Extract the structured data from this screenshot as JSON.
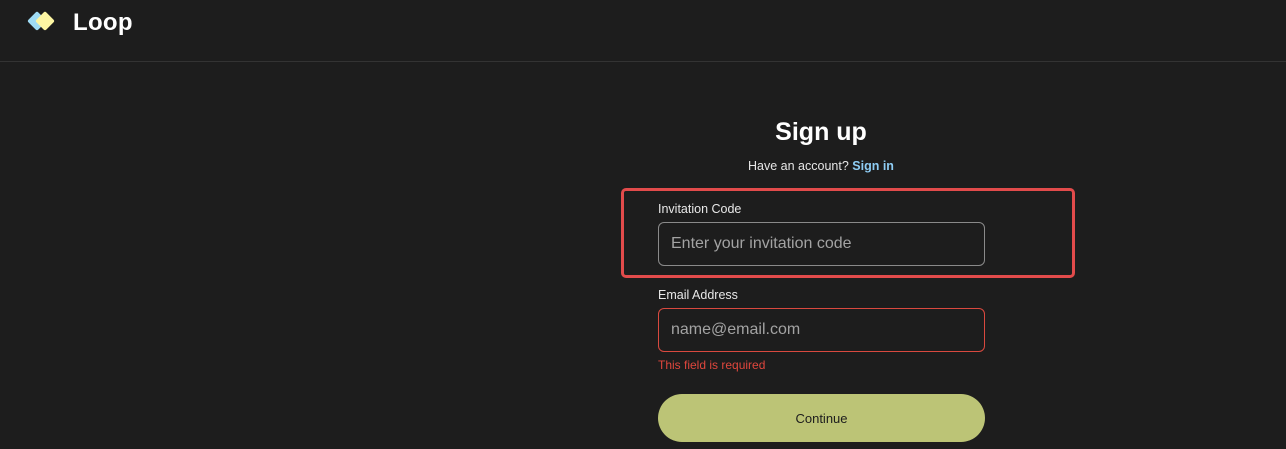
{
  "brand": {
    "name": "Loop",
    "colors": {
      "primary": "#fdf6a3",
      "secondary": "#9fdcf5"
    }
  },
  "signup": {
    "title": "Sign up",
    "have_account_text": "Have an account?",
    "sign_in_link": "Sign in",
    "invitation_code": {
      "label": "Invitation Code",
      "placeholder": "Enter your invitation code",
      "value": ""
    },
    "email": {
      "label": "Email Address",
      "placeholder": "name@email.com",
      "value": "",
      "error": "This field is required"
    },
    "continue_label": "Continue"
  },
  "colors": {
    "background": "#1d1d1d",
    "highlight_border": "#e24b4b",
    "error": "#e0473d",
    "button": "#bcc476",
    "link": "#8ecdf5"
  }
}
